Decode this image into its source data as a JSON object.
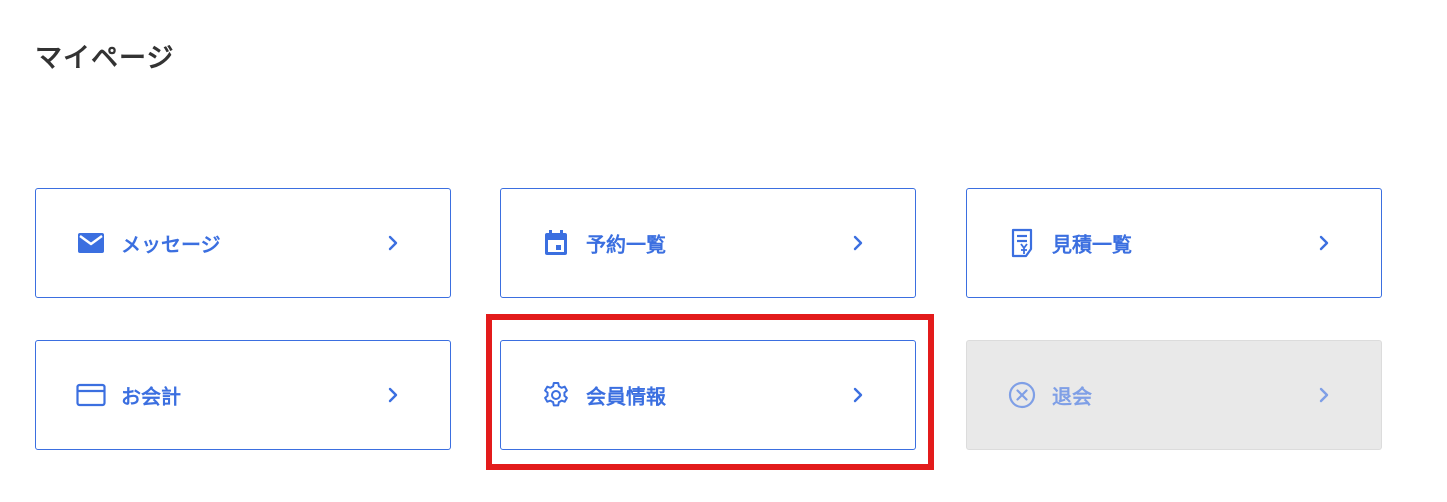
{
  "header": {
    "title": "マイページ"
  },
  "menu": {
    "items": [
      {
        "label": "メッセージ",
        "icon": "mail-icon",
        "enabled": true
      },
      {
        "label": "予約一覧",
        "icon": "calendar-icon",
        "enabled": true
      },
      {
        "label": "見積一覧",
        "icon": "receipt-icon",
        "enabled": true
      },
      {
        "label": "お会計",
        "icon": "credit-card-icon",
        "enabled": true
      },
      {
        "label": "会員情報",
        "icon": "gear-icon",
        "enabled": true,
        "highlighted": true
      },
      {
        "label": "退会",
        "icon": "circle-x-icon",
        "enabled": false
      }
    ]
  },
  "colors": {
    "accent": "#3b6fe0",
    "accent_disabled": "#7f9fe6",
    "disabled_background": "#e9e9e9",
    "highlight": "#e31b1b",
    "title": "#333333"
  }
}
